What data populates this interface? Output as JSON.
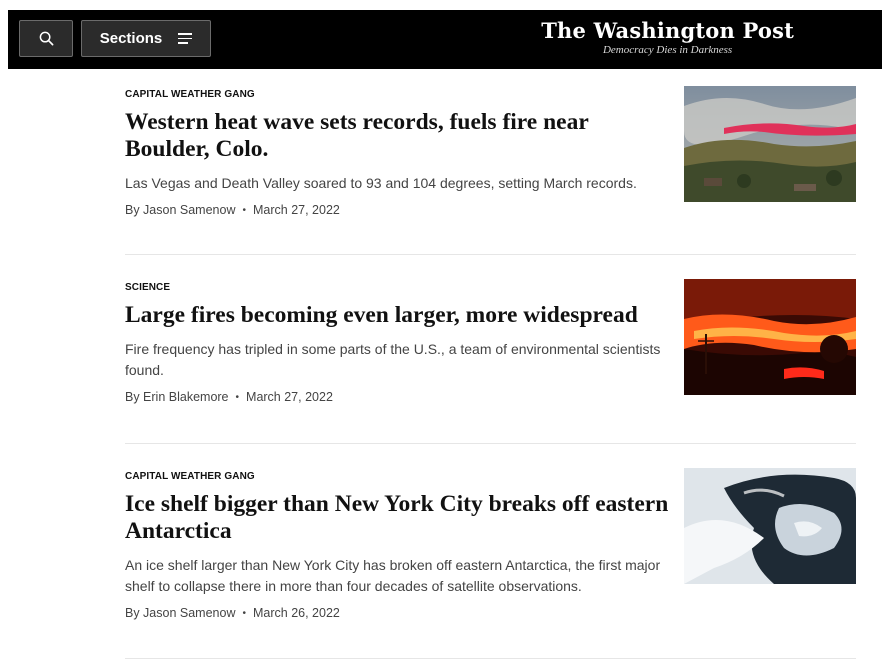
{
  "header": {
    "sections_label": "Sections",
    "brand_name": "The Washington Post",
    "brand_tagline": "Democracy Dies in Darkness",
    "search_icon": "search-icon",
    "menu_icon": "hamburger-menu-icon"
  },
  "stories": [
    {
      "kicker": "CAPITAL WEATHER GANG",
      "headline": "Western heat wave sets records, fuels fire near Boulder, Colo.",
      "blurb": "Las Vegas and Death Valley soared to 93 and 104 degrees, setting March records.",
      "author": "By Jason Samenow",
      "date": "March 27, 2022"
    },
    {
      "kicker": "SCIENCE",
      "headline": "Large fires becoming even larger, more widespread",
      "blurb": "Fire frequency has tripled in some parts of the U.S., a team of environmental scientists found.",
      "author": "By Erin Blakemore",
      "date": "March 27, 2022"
    },
    {
      "kicker": "CAPITAL WEATHER GANG",
      "headline": "Ice shelf bigger than New York City breaks off eastern Antarctica",
      "blurb": "An ice shelf larger than New York City has broken off eastern Antarctica, the first major shelf to collapse there in more than four decades of satellite observations.",
      "author": "By Jason Samenow",
      "date": "March 26, 2022"
    }
  ],
  "colors": {
    "topbar": "#000000",
    "button_bg": "#2b2b2b",
    "text_secondary": "#444444"
  }
}
